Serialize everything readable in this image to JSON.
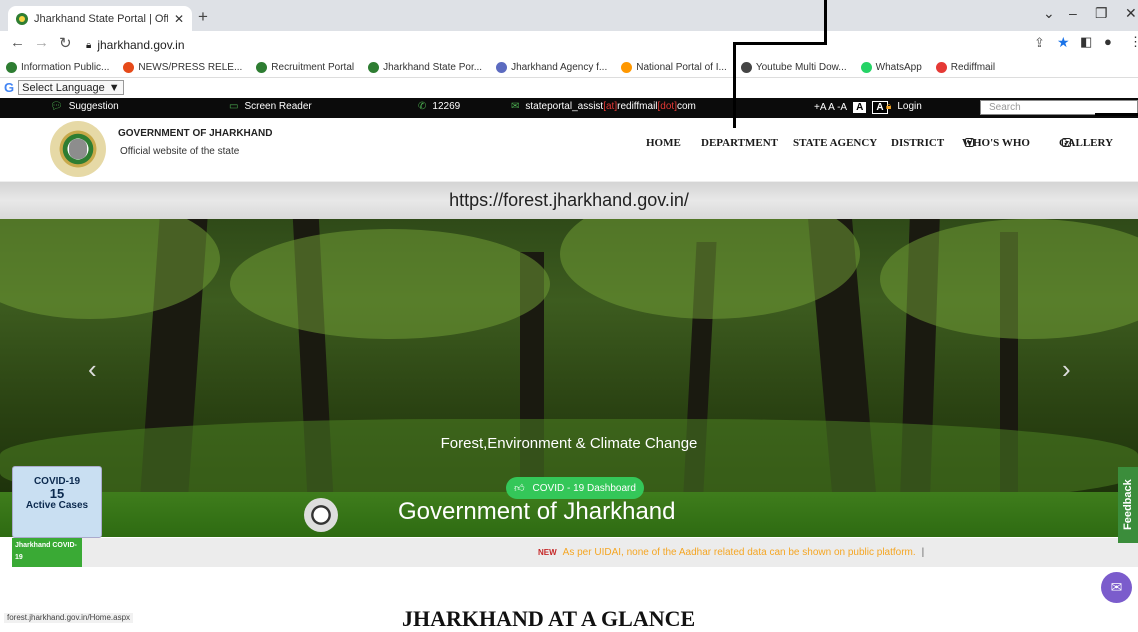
{
  "browser": {
    "tab_title": "Jharkhand State Portal | Official W",
    "url": "jharkhand.gov.in",
    "status_url": "forest.jharkhand.gov.in/Home.aspx",
    "bookmarks": [
      {
        "label": "Information Public...",
        "color": "#2e7d32"
      },
      {
        "label": "NEWS/PRESS RELE...",
        "color": "#e64a19"
      },
      {
        "label": "Recruitment Portal",
        "color": "#2e7d32"
      },
      {
        "label": "Jharkhand State Por...",
        "color": "#2e7d32"
      },
      {
        "label": "Jharkhand Agency f...",
        "color": "#5c6bc0"
      },
      {
        "label": "National Portal of I...",
        "color": "#ff9800"
      },
      {
        "label": "Youtube Multi Dow...",
        "color": "#444444"
      },
      {
        "label": "WhatsApp",
        "color": "#25d366"
      },
      {
        "label": "Rediffmail",
        "color": "#e53935"
      }
    ]
  },
  "translate": {
    "label": "Select Language"
  },
  "topstrip": {
    "suggestion": "Suggestion",
    "screen_reader": "Screen Reader",
    "phone": "12269",
    "email_pre": "stateportal_assist",
    "email_at": "[at]",
    "email_mid": "rediffmail",
    "email_dot": "[dot]",
    "email_post": "com",
    "font_sizes": "+A A -A",
    "a1": "A",
    "a2": "A",
    "login": "Login",
    "search_placeholder": "Search"
  },
  "header": {
    "title": "GOVERNMENT OF JHARKHAND",
    "subtitle": "Official website of the state"
  },
  "menu": {
    "home": "HOME",
    "department": "DEPARTMENT",
    "state_agency": "STATE AGENCY",
    "district": "DISTRICT",
    "whos_who": "WHO'S WHO",
    "gallery": "GALLERY"
  },
  "slider": {
    "url_text": "https://forest.jharkhand.gov.in/",
    "caption": "Forest,Environment & Climate Change",
    "banner": "Government of Jharkhand",
    "covid_button": "COVID - 19 Dashboard"
  },
  "covid": {
    "title": "COVID-19",
    "count": "15",
    "label": "Active Cases",
    "tag": "Jharkhand COVID-19"
  },
  "ticker": {
    "new": "NEW",
    "text": "As per UIDAI, none of the Aadhar related data can be shown on public platform.",
    "sep": "|"
  },
  "feedback": "Feedback",
  "section_heading": "JHARKHAND AT A GLANCE"
}
